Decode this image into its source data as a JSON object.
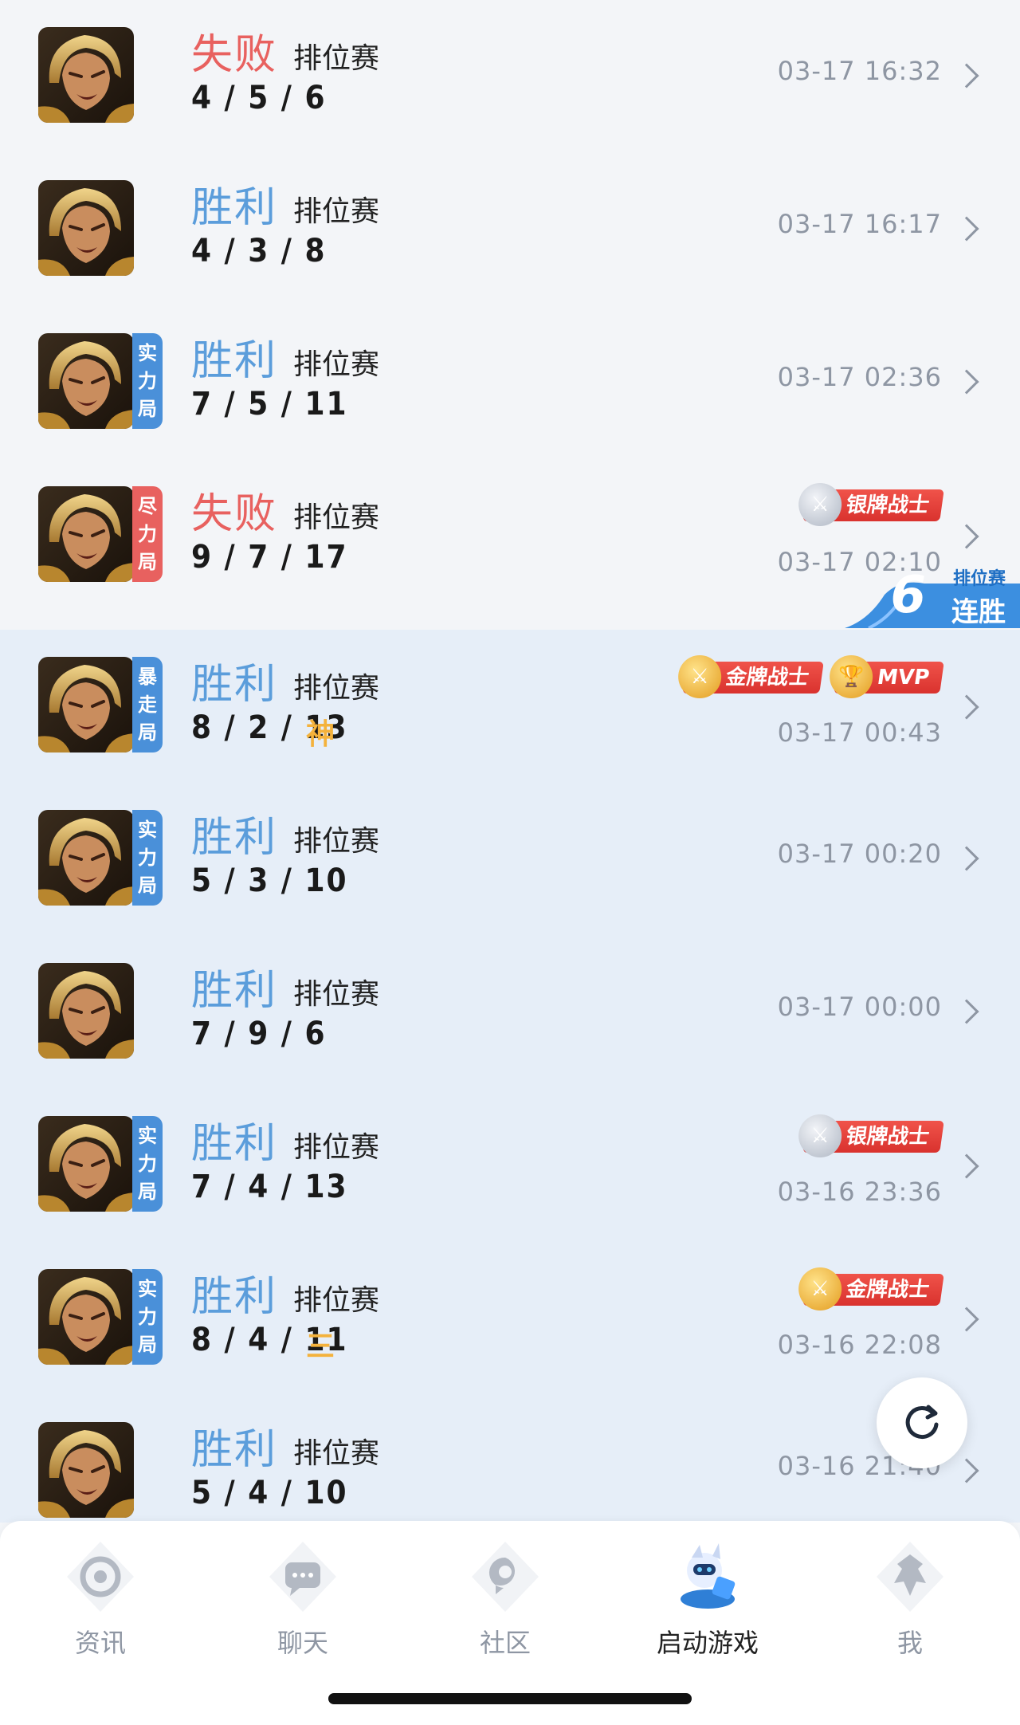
{
  "matches": [
    {
      "result": "失败",
      "type": "排位赛",
      "kda": "4 / 5 / 6",
      "time": "03-17 16:32",
      "mode": null,
      "honor": null,
      "badges": []
    },
    {
      "result": "胜利",
      "type": "排位赛",
      "kda": "4 / 3 / 8",
      "time": "03-17 16:17",
      "mode": null,
      "honor": null,
      "badges": []
    },
    {
      "result": "胜利",
      "type": "排位赛",
      "kda": "7 / 5 / 11",
      "time": "03-17 02:36",
      "mode": "实力局",
      "honor": null,
      "badges": []
    },
    {
      "result": "失败",
      "type": "排位赛",
      "kda": "9 / 7 / 17",
      "time": "03-17 02:10",
      "mode": "尽力局",
      "honor": null,
      "badges": [
        "银牌战士"
      ]
    },
    {
      "result": "胜利",
      "type": "排位赛",
      "kda": "8 / 2 / 13",
      "time": "03-17 00:43",
      "mode": "暴走局",
      "honor": "神",
      "badges": [
        "金牌战士",
        "MVP"
      ]
    },
    {
      "result": "胜利",
      "type": "排位赛",
      "kda": "5 / 3 / 10",
      "time": "03-17 00:20",
      "mode": "实力局",
      "honor": null,
      "badges": []
    },
    {
      "result": "胜利",
      "type": "排位赛",
      "kda": "7 / 9 / 6",
      "time": "03-17 00:00",
      "mode": null,
      "honor": null,
      "badges": []
    },
    {
      "result": "胜利",
      "type": "排位赛",
      "kda": "7 / 4 / 13",
      "time": "03-16 23:36",
      "mode": "实力局",
      "honor": null,
      "badges": [
        "银牌战士"
      ]
    },
    {
      "result": "胜利",
      "type": "排位赛",
      "kda": "8 / 4 / 11",
      "time": "03-16 22:08",
      "mode": "实力局",
      "honor": "三",
      "badges": [
        "金牌战士"
      ]
    },
    {
      "result": "胜利",
      "type": "排位赛",
      "kda": "5 / 4 / 10",
      "time": "03-16 21:40",
      "mode": null,
      "honor": null,
      "badges": []
    }
  ],
  "streak": {
    "number": "6",
    "label_top": "排位赛",
    "label_bottom": "连胜"
  },
  "tabs": [
    {
      "label": "资讯",
      "icon": "news-icon"
    },
    {
      "label": "聊天",
      "icon": "chat-icon"
    },
    {
      "label": "社区",
      "icon": "community-icon"
    },
    {
      "label": "启动游戏",
      "icon": "launch-game-mascot-icon"
    },
    {
      "label": "我",
      "icon": "profile-icon"
    }
  ],
  "colors": {
    "win": "#5b9ddb",
    "lose": "#e8615f",
    "mode_blue": "#4a90d9",
    "mode_red": "#e8615f",
    "highlight_band": "#e6eef8",
    "badge_red": "#e0413a",
    "honor_gold": "#f4b23c"
  }
}
